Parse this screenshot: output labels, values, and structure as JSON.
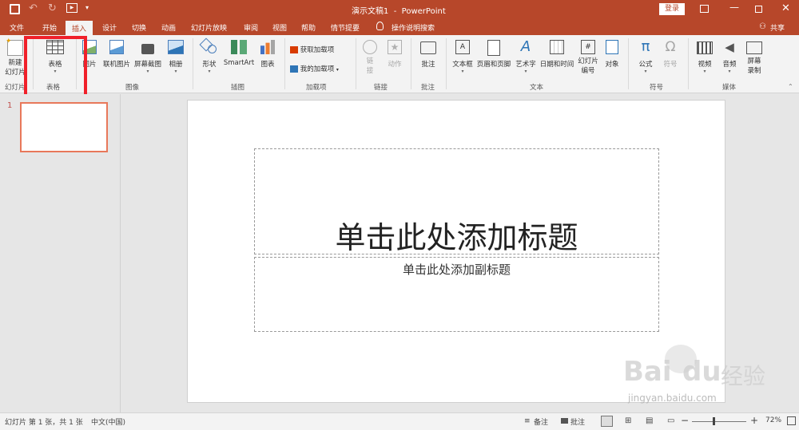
{
  "title_bar": {
    "title": "演示文稿1  -  PowerPoint",
    "login_label": "登录",
    "qat_icons": [
      "save-icon",
      "undo-icon",
      "redo-icon",
      "start-from-beginning-icon",
      "customize-qat-icon"
    ]
  },
  "tabs": [
    {
      "label": "文件"
    },
    {
      "label": "开始"
    },
    {
      "label": "插入",
      "active": true
    },
    {
      "label": "设计"
    },
    {
      "label": "切换"
    },
    {
      "label": "动画"
    },
    {
      "label": "幻灯片放映"
    },
    {
      "label": "审阅"
    },
    {
      "label": "视图"
    },
    {
      "label": "帮助"
    },
    {
      "label": "情节提要"
    }
  ],
  "tell_me": "操作说明搜索",
  "share_label": "共享",
  "ribbon": {
    "slides": {
      "new_slide_line1": "新建",
      "new_slide_line2": "幻灯片",
      "group": "幻灯片"
    },
    "tables": {
      "table": "表格",
      "group": "表格"
    },
    "images": {
      "picture": "图片",
      "online_picture": "联机图片",
      "screenshot": "屏幕截图",
      "album": "相册",
      "group": "图像"
    },
    "illustrations": {
      "shapes": "形状",
      "smartart": "SmartArt",
      "chart": "图表",
      "group": "插图"
    },
    "addins": {
      "get_addins": "获取加载项",
      "my_addins": "我的加载项",
      "group": "加载项"
    },
    "links": {
      "link_line1": "链",
      "link_line2": "接",
      "action": "动作",
      "group": "链接"
    },
    "comments": {
      "comment": "批注",
      "group": "批注"
    },
    "text": {
      "textbox": "文本框",
      "header_footer": "页眉和页脚",
      "wordart": "艺术字",
      "datetime": "日期和时间",
      "slide_number_line1": "幻灯片",
      "slide_number_line2": "编号",
      "object": "对象",
      "group": "文本"
    },
    "symbols": {
      "equation": "公式",
      "symbol": "符号",
      "group": "符号"
    },
    "media": {
      "video": "视频",
      "audio": "音频",
      "screen_rec_line1": "屏幕",
      "screen_rec_line2": "录制",
      "group": "媒体"
    }
  },
  "slide_panel": {
    "number": "1"
  },
  "slide": {
    "title_placeholder": "单击此处添加标题",
    "subtitle_placeholder": "单击此处添加副标题"
  },
  "status_bar": {
    "slide_info": "幻灯片 第 1 张，共 1 张",
    "language": "中文(中国)",
    "notes": "备注",
    "comments": "批注",
    "zoom": "72%"
  },
  "watermark": {
    "brand": "Bai",
    "brand2": "du",
    "cn": "经验",
    "url": "jingyan.baidu.com"
  },
  "colors": {
    "accent": "#b7472a",
    "highlight": "#f0202a"
  }
}
